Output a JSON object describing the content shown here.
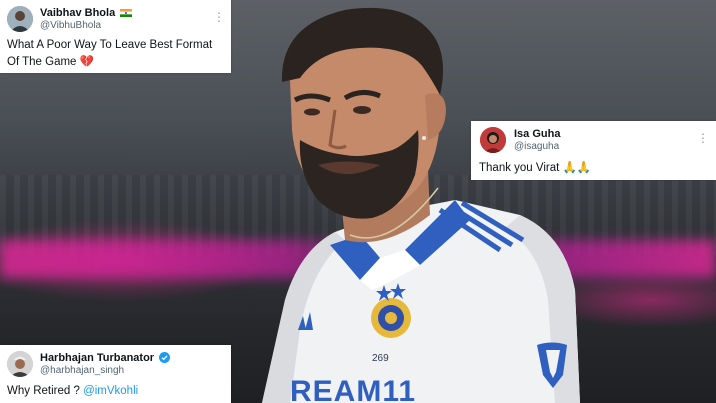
{
  "tweets": [
    {
      "name": "Vaibhav Bhola",
      "handle": "@VibhuBhola",
      "text_line1": "What A Poor Way To Leave Best Format",
      "text_line2": "Of The Game",
      "emoji": "💔",
      "flag": "india-flag"
    },
    {
      "name": "Isa Guha",
      "handle": "@isaguha",
      "text": "Thank you Virat",
      "emoji": "🙏🙏"
    },
    {
      "name": "Harbhajan Turbanator",
      "handle": "@harbhajan_singh",
      "text": "Why Retired ?",
      "mention": "@imVkohli",
      "badge": "verified-icon"
    }
  ],
  "photo": {
    "jersey_number": "269",
    "jersey_text": "REAM11"
  },
  "colors": {
    "mention": "#1d9bf0",
    "verified": "#1d9bf0"
  }
}
